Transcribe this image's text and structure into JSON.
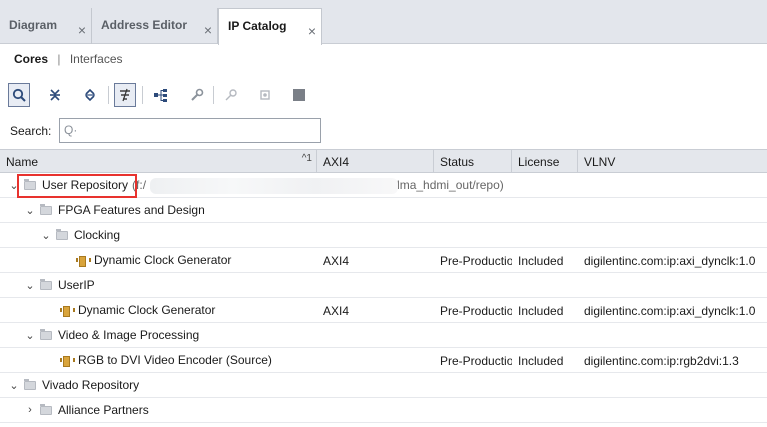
{
  "tabs": [
    {
      "label": "Diagram",
      "active": false
    },
    {
      "label": "Address Editor",
      "active": false
    },
    {
      "label": "IP Catalog",
      "active": true
    }
  ],
  "tab_close_glyph": "×",
  "subtabs": {
    "cores": "Cores",
    "separator": "|",
    "interfaces": "Interfaces"
  },
  "toolbar": {
    "icons": [
      "search-icon",
      "collapse-all-icon",
      "expand-all-icon",
      "filter-icon",
      "hierarchy-icon",
      "wrench-icon",
      "key-icon",
      "chip-settings-icon",
      "stop-icon"
    ]
  },
  "search": {
    "label": "Search:",
    "value": "",
    "placeholder": ""
  },
  "table": {
    "columns": [
      "Name",
      "AXI4",
      "Status",
      "License",
      "VLNV"
    ],
    "sort_indicator": "^1",
    "rows": [
      {
        "name": "User Repository",
        "suffix_left": "(f:/",
        "suffix_right": "vdma_hdmi_out/repo)",
        "axi4": "",
        "status": "",
        "license": "",
        "vlnv": ""
      },
      {
        "name": "FPGA Features and Design",
        "axi4": "",
        "status": "",
        "license": "",
        "vlnv": ""
      },
      {
        "name": "Clocking",
        "axi4": "",
        "status": "",
        "license": "",
        "vlnv": ""
      },
      {
        "name": "Dynamic Clock Generator",
        "axi4": "AXI4",
        "status": "Pre-Production",
        "license": "Included",
        "vlnv": "digilentinc.com:ip:axi_dynclk:1.0"
      },
      {
        "name": "UserIP",
        "axi4": "",
        "status": "",
        "license": "",
        "vlnv": ""
      },
      {
        "name": "Dynamic Clock Generator",
        "axi4": "AXI4",
        "status": "Pre-Production",
        "license": "Included",
        "vlnv": "digilentinc.com:ip:axi_dynclk:1.0"
      },
      {
        "name": "Video & Image Processing",
        "axi4": "",
        "status": "",
        "license": "",
        "vlnv": ""
      },
      {
        "name": "RGB to DVI Video Encoder (Source)",
        "axi4": "",
        "status": "Pre-Production",
        "license": "Included",
        "vlnv": "digilentinc.com:ip:rgb2dvi:1.3"
      },
      {
        "name": "Vivado Repository",
        "axi4": "",
        "status": "",
        "license": "",
        "vlnv": ""
      },
      {
        "name": "Alliance Partners",
        "axi4": "",
        "status": "",
        "license": "",
        "vlnv": ""
      }
    ]
  },
  "colors": {
    "highlight_box": "#e8322e",
    "ip_icon": "#d9a43b"
  }
}
